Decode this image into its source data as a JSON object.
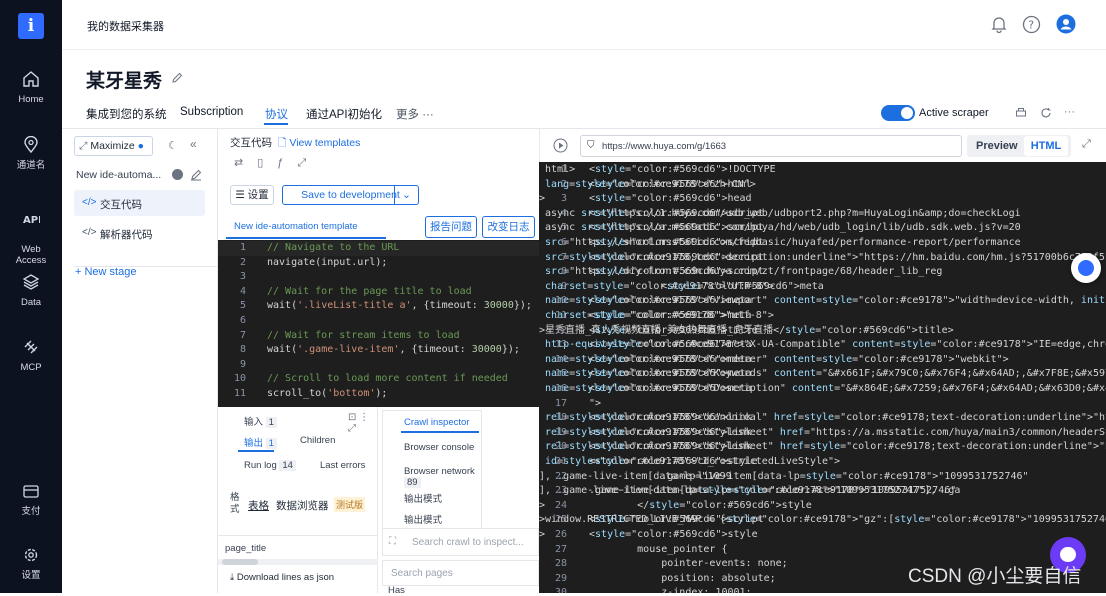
{
  "rail": {
    "logo": "i",
    "items": [
      {
        "label": "Home",
        "icon": "home-icon"
      },
      {
        "label": "通道名",
        "icon": "location-pin-icon"
      },
      {
        "label": "Web\nAccess",
        "icon": "api-icon"
      },
      {
        "label": "Data",
        "icon": "layers-icon"
      },
      {
        "label": "MCP",
        "icon": "mcp-icon"
      },
      {
        "label": "支付",
        "icon": "wallet-icon"
      },
      {
        "label": "设置",
        "icon": "gear-icon"
      }
    ]
  },
  "header": {
    "breadcrumb": "我的数据采集器",
    "icons": [
      "bell-icon",
      "help-icon",
      "user-icon"
    ]
  },
  "title": "某牙星秀",
  "tabs": [
    "集成到您的系统",
    "Subscription",
    "协议",
    "通过API初始化",
    "更多 ···"
  ],
  "active_tab": 2,
  "scraper": {
    "label": "Active scraper",
    "enabled": true
  },
  "left": {
    "maximize": "Maximize",
    "template": "New ide-automa...",
    "items": [
      "交互代码",
      "解析器代码"
    ],
    "new_stage": "+ New stage"
  },
  "code_panel": {
    "title": "交互代码",
    "view_templates": "View templates",
    "settings": "设置",
    "save": "Save to development",
    "template_tab": "New ide-automation template",
    "report": "报告问题",
    "changelog": "改变日志",
    "lines": [
      "// Navigate to the URL",
      "navigate(input.url);",
      "",
      "// Wait for the page title to load",
      "wait('.liveList-title a', {timeout: 30000});",
      "",
      "// Wait for stream items to load",
      "wait('.game-live-item', {timeout: 30000});",
      "",
      "// Scroll to load more content if needed",
      "scroll_to('bottom');"
    ]
  },
  "bottom": {
    "input": "输入",
    "input_count": "1",
    "output": "输出",
    "output_count": "1",
    "children": "Children",
    "runlog": "Run log",
    "runlog_count": "14",
    "errors": "Last errors",
    "format_label": "格式",
    "table": "表格",
    "data_browser": "数据浏览器",
    "beta": "测试版",
    "col": "page_title",
    "download": "Download lines as json",
    "inspector": [
      "Crawl inspector",
      "Browser console",
      "Browser network",
      "输出模式",
      "输出模式"
    ],
    "network_count": "89",
    "search_crawl": "Search crawl to inspect...",
    "search_pages": "Search pages",
    "has": "Has"
  },
  "browser": {
    "url": "https://www.huya.com/g/1663",
    "preview": "Preview",
    "html": "HTML",
    "lines": [
      "<!DOCTYPE html>",
      "<html lang=\"zh-CN\">",
      "<head>",
      "<script async src=\"https://1.huya.com/udb_web/udbport2.php?m=HuyaLogin&amp;do=checkLogi",
      "<script async src=\"https://a.msstatic.com/huya/hd/web/udb_login/lib/udb.sdk.web.js?v=20",
      "<script src=\"https://short.msstatic.com/fedbasic/huyafed/performance-report/performance",
      "<script src=\"https://hm.baidu.com/hm.js?51700b6c722f5bb4cf39906a596ea41f\"></script",
      "<script src=\"https://diy-front.cdn.huya.com/zt/frontpage/68/header_lib_reg",
      "            <meta charset=\"UTF-8\">",
      "<meta name=\"viewport\" content=\"width=device-width, initial-scale=1.0\">",
      "<meta charset=\"utf-8\">",
      "<title>星秀直播_真人秀视频直播_美女热舞直播_虎牙直播</title>",
      "<meta http-equiv=\"X-UA-Compatible\" content=\"IE=edge,chrome=1\">",
      "<meta name=\"renderer\" content=\"webkit\">",
      "<meta name=\"Keywords\" content=\"&#x661F;&#x79C0;&#x76F4;&#x64AD;,&#x7F8E;&#x5973;&#x76F4",
      "<meta name=\"Description\" content=\"&#x864E;&#x7259;&#x76F4;&#x64AD;&#x63D0;&#x4F9B;&#x6D",
      "\">",
      "<link rel=\"canonical\" href=\"https://www.huya.com/g/1663\">",
      "<link rel=\"stylesheet\" href=\"https://a.msstatic.com/huya/main3/common/headerStyle_b6fcf",
      "<link rel=\"stylesheet\" href=\"https://a.msstatic.com/huya/main3/app/game-live_9650c.css\"",
      "<style id=\"J_restrictedLiveStyle\">",
      "            .game-live-item[data-lp=\"1099531752746\"], .game-live-item[data-lp=\"1099",
      ".game-live-item[data-lp=\"1099531752746\"], .game-live-item[data-lp=\"1099531752747\"], .ga",
      "        </style>",
      "<script>window.RESTRICTED_LIVE_MAP = {\"gz\":[\"1099531752746\",\"1099531752747\",\"109953175",
      "<style>",
      "        mouse_pointer {",
      "            pointer-events: none;",
      "            position: absolute;",
      "            z-index: 10001;"
    ]
  },
  "watermark": "CSDN @小尘要自信"
}
